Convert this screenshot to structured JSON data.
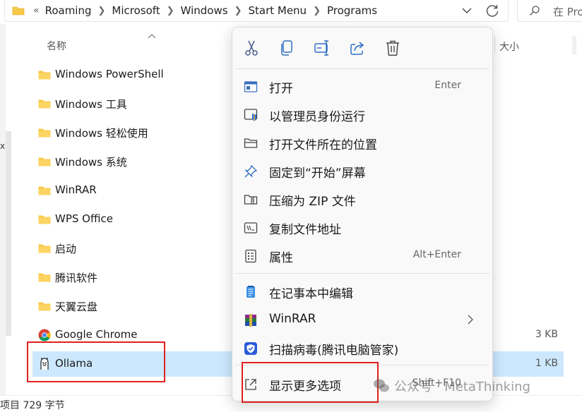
{
  "address_bar": {
    "breadcrumbs": [
      "Roaming",
      "Microsoft",
      "Windows",
      "Start Menu",
      "Programs"
    ],
    "overflow_glyph": "«",
    "search_placeholder": "在 Pro"
  },
  "columns": {
    "name": "名称",
    "size": "大小"
  },
  "files": [
    {
      "name": "Windows PowerShell",
      "icon": "folder-icon",
      "size": ""
    },
    {
      "name": "Windows 工具",
      "icon": "folder-icon",
      "size": ""
    },
    {
      "name": "Windows 轻松使用",
      "icon": "folder-icon",
      "size": ""
    },
    {
      "name": "Windows 系统",
      "icon": "folder-icon",
      "size": ""
    },
    {
      "name": "WinRAR",
      "icon": "folder-icon",
      "size": ""
    },
    {
      "name": "WPS Office",
      "icon": "folder-icon",
      "size": ""
    },
    {
      "name": "启动",
      "icon": "folder-icon",
      "size": ""
    },
    {
      "name": "腾讯软件",
      "icon": "folder-icon",
      "size": ""
    },
    {
      "name": "天翼云盘",
      "icon": "folder-icon",
      "size": ""
    },
    {
      "name": "Google Chrome",
      "icon": "chrome-icon",
      "size": "3 KB"
    },
    {
      "name": "Ollama",
      "icon": "ollama-icon",
      "size": "1 KB",
      "selected": true
    }
  ],
  "status_bar": {
    "text": "项目  729 字节"
  },
  "context_menu": {
    "toolbar": [
      "cut-icon",
      "copy-icon",
      "rename-icon",
      "share-icon",
      "delete-icon"
    ],
    "items": [
      {
        "label": "打开",
        "shortcut": "Enter",
        "icon": "open-icon"
      },
      {
        "label": "以管理员身份运行",
        "shortcut": "",
        "icon": "shield-icon"
      },
      {
        "label": "打开文件所在的位置",
        "shortcut": "",
        "icon": "folder-outline-icon"
      },
      {
        "label": "固定到“开始”屏幕",
        "shortcut": "",
        "icon": "pin-icon"
      },
      {
        "label": "压缩为 ZIP 文件",
        "shortcut": "",
        "icon": "zip-icon"
      },
      {
        "label": "复制文件地址",
        "shortcut": "",
        "icon": "copy-path-icon"
      },
      {
        "label": "属性",
        "shortcut": "Alt+Enter",
        "icon": "properties-icon"
      },
      {
        "label": "在记事本中编辑",
        "shortcut": "",
        "icon": "notepad-icon"
      },
      {
        "label": "WinRAR",
        "shortcut": "",
        "icon": "winrar-icon",
        "submenu": true
      },
      {
        "label": "扫描病毒(腾讯电脑管家)",
        "shortcut": "",
        "icon": "tencent-shield-icon"
      },
      {
        "label": "显示更多选项",
        "shortcut": "Shift+F10",
        "icon": "more-options-icon"
      }
    ]
  },
  "watermark": {
    "text": "公众号 · MetaThinking"
  },
  "colors": {
    "selection": "#cce8ff",
    "highlight_box": "#e0201e",
    "folder": "#f8c948",
    "accent": "#0067c0"
  }
}
